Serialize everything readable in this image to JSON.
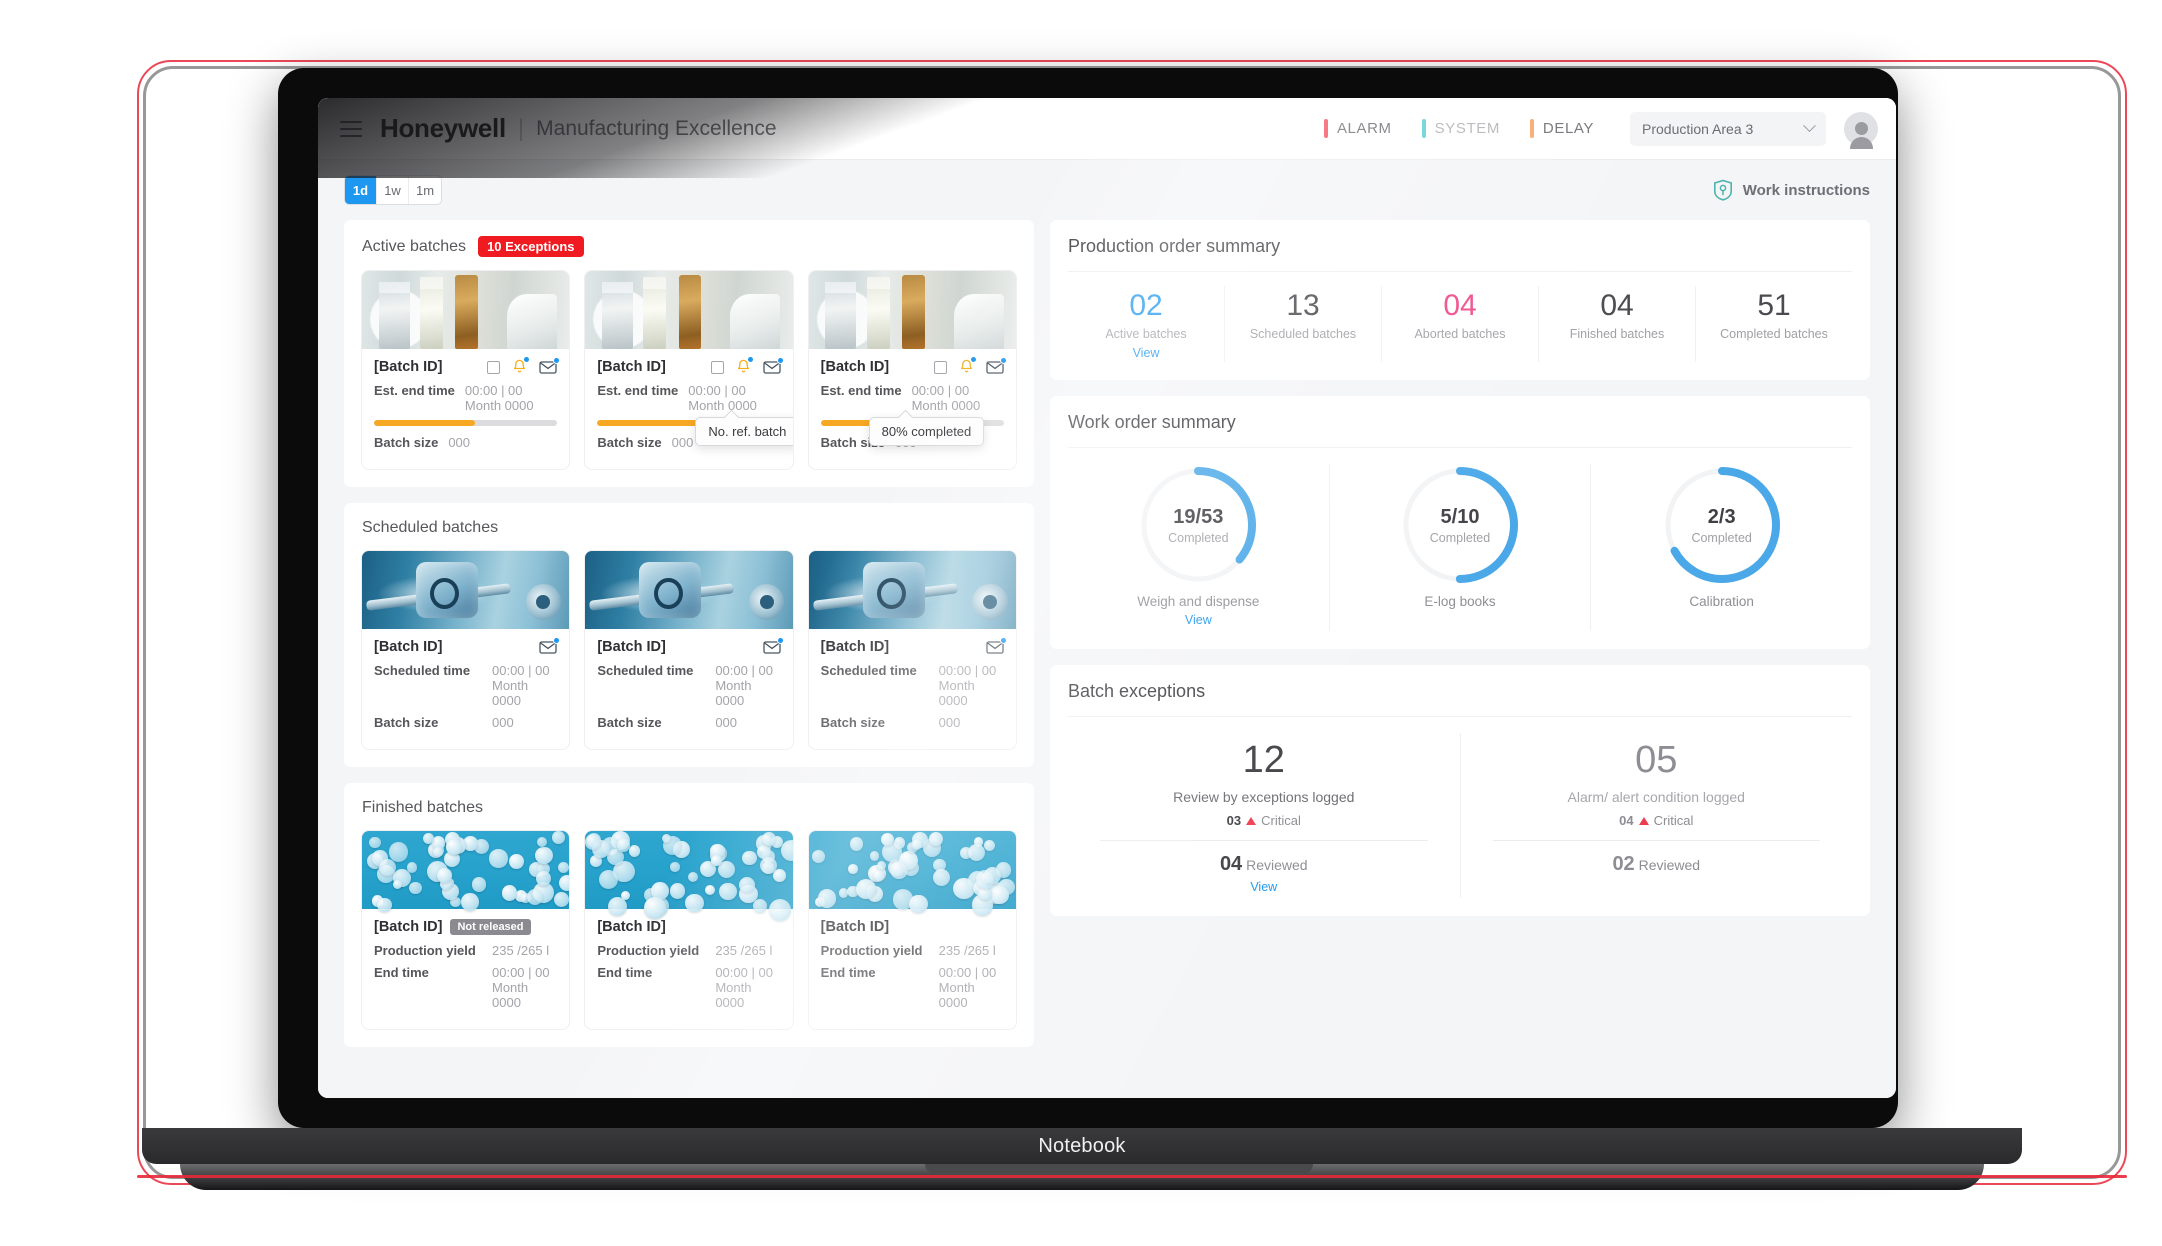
{
  "device": {
    "label": "Notebook"
  },
  "header": {
    "menu_icon": "hamburger-icon",
    "brand": "Honeywell",
    "separator": "|",
    "subtitle": "Manufacturing Excellence",
    "statuses": [
      {
        "label": "ALARM",
        "color": "#f4515f"
      },
      {
        "label": "SYSTEM",
        "color": "#5fd0d8"
      },
      {
        "label": "DELAY",
        "color": "#f9a66c"
      }
    ],
    "area_select": {
      "value": "Production Area 3",
      "icon": "chevron-down-icon"
    },
    "avatar": "user-avatar"
  },
  "toolbar": {
    "ranges": [
      {
        "label": "1d",
        "active": true
      },
      {
        "label": "1w",
        "active": false
      },
      {
        "label": "1m",
        "active": false
      }
    ],
    "work_instructions": {
      "label": "Work instructions",
      "icon": "shield-badge-icon",
      "color": "#4fb3ad"
    }
  },
  "active_batches": {
    "title": "Active batches",
    "exceptions_badge": "10 Exceptions",
    "cards": [
      {
        "batch_id": "[Batch ID]",
        "time_label": "Est. end time",
        "time_value": "00:00 | 00 Month 0000",
        "progress": 55,
        "size_label": "Batch size",
        "size_value": "000"
      },
      {
        "batch_id": "[Batch ID]",
        "time_label": "Est. end time",
        "time_value": "00:00 | 00 Month 0000",
        "progress": 58,
        "size_label": "Batch size",
        "size_value": "000"
      },
      {
        "batch_id": "[Batch ID]",
        "time_label": "Est. end time",
        "time_value": "00:00 | 00 Month 0000",
        "progress": 55,
        "size_label": "Batch size",
        "size_value": "000"
      }
    ],
    "tooltips": {
      "no_ref_batch": "No. ref. batch",
      "percent_completed": "80% completed"
    }
  },
  "scheduled_batches": {
    "title": "Scheduled batches",
    "cards": [
      {
        "batch_id": "[Batch ID]",
        "time_label": "Scheduled time",
        "time_value": "00:00 | 00 Month 0000",
        "size_label": "Batch size",
        "size_value": "000"
      },
      {
        "batch_id": "[Batch ID]",
        "time_label": "Scheduled time",
        "time_value": "00:00 | 00 Month 0000",
        "size_label": "Batch size",
        "size_value": "000"
      },
      {
        "batch_id": "[Batch ID]",
        "time_label": "Scheduled time",
        "time_value": "00:00 | 00 Month 0000",
        "size_label": "Batch size",
        "size_value": "000"
      }
    ]
  },
  "finished_batches": {
    "title": "Finished batches",
    "cards": [
      {
        "batch_id": "[Batch ID]",
        "status_chip": "Not released",
        "yield_label": "Production yield",
        "yield_value": "235 /265 l",
        "end_label": "End time",
        "end_value": "00:00 | 00 Month 0000"
      },
      {
        "batch_id": "[Batch ID]",
        "status_chip": "",
        "yield_label": "Production yield",
        "yield_value": "235 /265 l",
        "end_label": "End time",
        "end_value": "00:00 | 00 Month 0000"
      },
      {
        "batch_id": "[Batch ID]",
        "status_chip": "",
        "yield_label": "Production yield",
        "yield_value": "235 /265 l",
        "end_label": "End time",
        "end_value": "00:00 | 00 Month 0000"
      }
    ]
  },
  "production_order_summary": {
    "title": "Production order summary",
    "stats": [
      {
        "value": "02",
        "label": "Active batches",
        "color": "#1d97ef",
        "link": "View"
      },
      {
        "value": "13",
        "label": "Scheduled batches",
        "color": "#4a4a4f",
        "link": ""
      },
      {
        "value": "04",
        "label": "Aborted batches",
        "color": "#ef4a8b",
        "link": ""
      },
      {
        "value": "04",
        "label": "Finished batches",
        "color": "#4a4a4f",
        "link": ""
      },
      {
        "value": "51",
        "label": "Completed batches",
        "color": "#4a4a4f",
        "link": ""
      }
    ]
  },
  "work_order_summary": {
    "title": "Work order summary",
    "donuts": [
      {
        "value": "19/53",
        "sub": "Completed",
        "label": "Weigh and dispense",
        "percent": 36,
        "link": "View"
      },
      {
        "value": "5/10",
        "sub": "Completed",
        "label": "E-log books",
        "percent": 50,
        "link": ""
      },
      {
        "value": "2/3",
        "sub": "Completed",
        "label": "Calibration",
        "percent": 67,
        "link": ""
      }
    ],
    "arc_color": "#4aa8e8",
    "track_color": "#f2f3f5"
  },
  "batch_exceptions": {
    "title": "Batch exceptions",
    "cells": [
      {
        "value": "12",
        "label": "Review by exceptions logged",
        "critical_value": "03",
        "critical_label": "Critical",
        "reviewed_value": "04",
        "reviewed_label": "Reviewed",
        "link": "View"
      },
      {
        "value": "05",
        "label": "Alarm/ alert condition logged",
        "critical_value": "04",
        "critical_label": "Critical",
        "reviewed_value": "02",
        "reviewed_label": "Reviewed",
        "link": ""
      }
    ]
  },
  "chart_data": {
    "type": "pie",
    "title": "Work order summary donuts",
    "series": [
      {
        "name": "Weigh and dispense",
        "completed": 19,
        "total": 53,
        "percent": 36
      },
      {
        "name": "E-log books",
        "completed": 5,
        "total": 10,
        "percent": 50
      },
      {
        "name": "Calibration",
        "completed": 2,
        "total": 3,
        "percent": 67
      }
    ],
    "legend_position": "below",
    "grid": false
  }
}
